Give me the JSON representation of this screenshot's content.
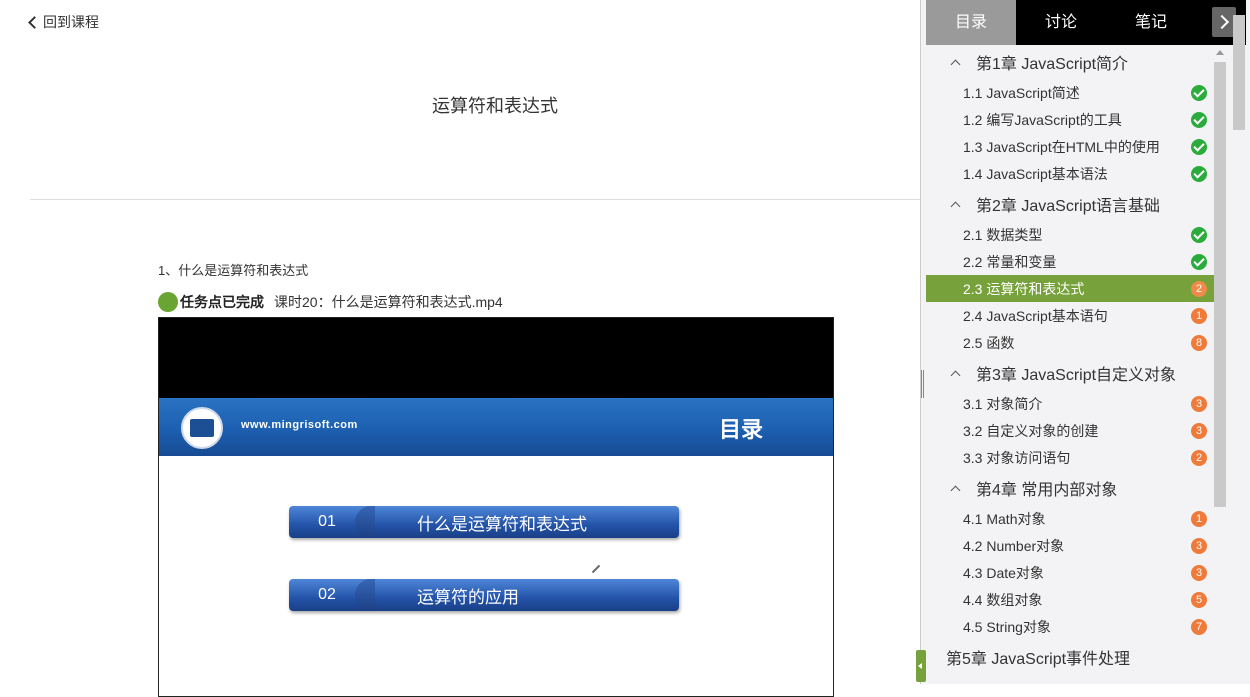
{
  "header": {
    "back_label": "回到课程",
    "title": "运算符和表达式"
  },
  "content": {
    "section_heading": "1、什么是运算符和表达式",
    "task_status": "任务点已完成",
    "task_file": "课时20：什么是运算符和表达式.mp4"
  },
  "video": {
    "slide_url": "www.mingrisoft.com",
    "slide_title": "目录",
    "items": [
      {
        "num": "01",
        "text": "什么是运算符和表达式"
      },
      {
        "num": "02",
        "text": "运算符的应用"
      }
    ]
  },
  "panel": {
    "tabs": [
      "目录",
      "讨论",
      "笔记"
    ],
    "active_tab": 0,
    "chapters": [
      {
        "title": "第1章 JavaScript简介",
        "expanded": true,
        "items": [
          {
            "label": "1.1 JavaScript简述",
            "status": "done"
          },
          {
            "label": "1.2 编写JavaScript的工具",
            "status": "done"
          },
          {
            "label": "1.3 JavaScript在HTML中的使用",
            "status": "done"
          },
          {
            "label": "1.4 JavaScript基本语法",
            "status": "done"
          }
        ]
      },
      {
        "title": "第2章 JavaScript语言基础",
        "expanded": true,
        "items": [
          {
            "label": "2.1 数据类型",
            "status": "done"
          },
          {
            "label": "2.2 常量和变量",
            "status": "done"
          },
          {
            "label": "2.3 运算符和表达式",
            "status": "2",
            "active": true
          },
          {
            "label": "2.4 JavaScript基本语句",
            "status": "1"
          },
          {
            "label": "2.5 函数",
            "status": "8"
          }
        ]
      },
      {
        "title": "第3章 JavaScript自定义对象",
        "expanded": true,
        "items": [
          {
            "label": "3.1 对象简介",
            "status": "3"
          },
          {
            "label": "3.2 自定义对象的创建",
            "status": "3"
          },
          {
            "label": "3.3 对象访问语句",
            "status": "2"
          }
        ]
      },
      {
        "title": "第4章 常用内部对象",
        "expanded": true,
        "items": [
          {
            "label": "4.1 Math对象",
            "status": "1"
          },
          {
            "label": "4.2 Number对象",
            "status": "3"
          },
          {
            "label": "4.3 Date对象",
            "status": "3"
          },
          {
            "label": "4.4 数组对象",
            "status": "5"
          },
          {
            "label": "4.5 String对象",
            "status": "7"
          }
        ]
      },
      {
        "title": "第5章 JavaScript事件处理",
        "expanded": false,
        "items": []
      }
    ]
  }
}
